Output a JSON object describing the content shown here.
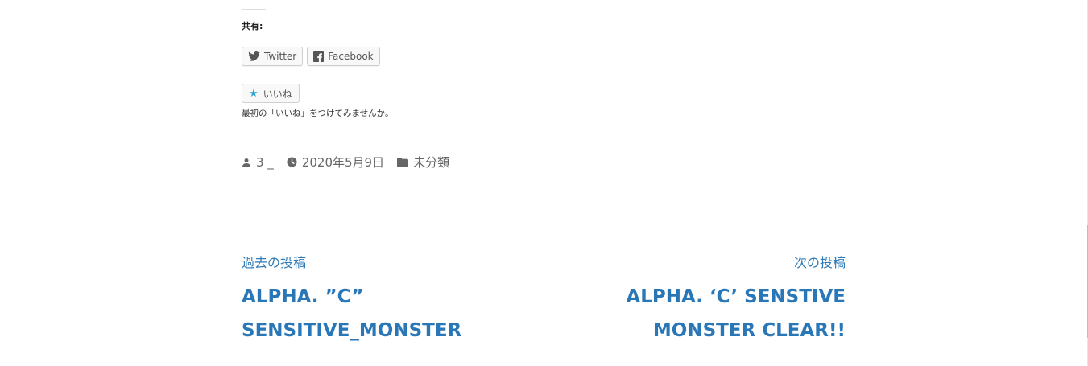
{
  "share": {
    "title": "共有:",
    "twitter_label": "Twitter",
    "facebook_label": "Facebook"
  },
  "like": {
    "button_label": "いいね",
    "note": "最初の「いいね」をつけてみませんか。"
  },
  "meta": {
    "author": "3 _",
    "date": "2020年5月9日",
    "category": "未分類"
  },
  "post_nav": {
    "prev_label": "過去の投稿",
    "prev_title_line1": "ALPHA. ”C”",
    "prev_title_line2": "SENSITIVE_MONSTER",
    "next_label": "次の投稿",
    "next_title_line1": "ALPHA. ‘C’ SENSTIVE",
    "next_title_line2": "MONSTER CLEAR!!"
  },
  "colors": {
    "link": "#2a77b8",
    "like_star": "#2aa2c9",
    "meta_text": "#666666"
  }
}
